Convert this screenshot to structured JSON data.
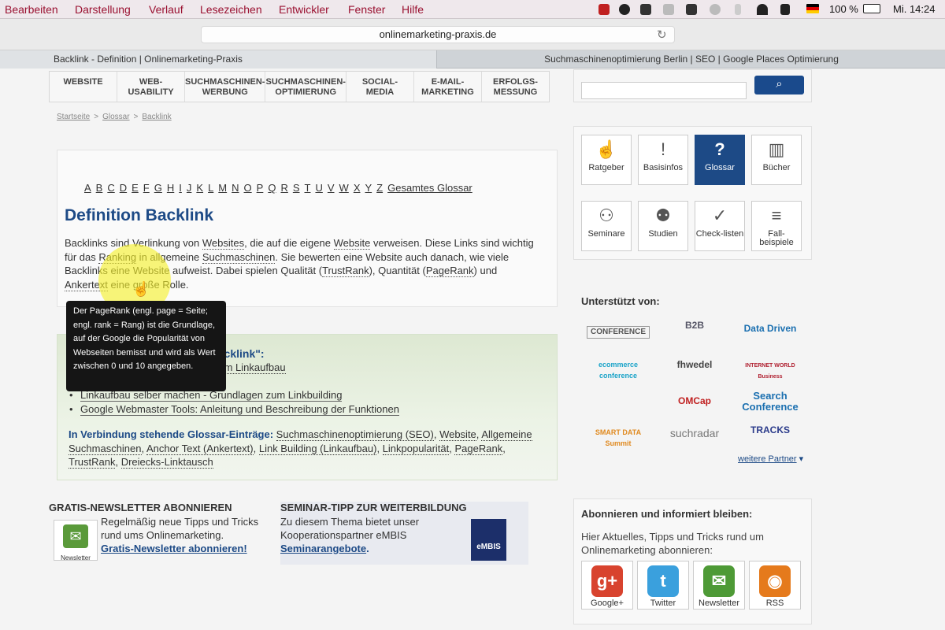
{
  "menubar": {
    "items": [
      "Bearbeiten",
      "Darstellung",
      "Verlauf",
      "Lesezeichen",
      "Entwickler",
      "Fenster",
      "Hilfe"
    ],
    "battery": "100 %",
    "clock": "Mi. 14:24"
  },
  "browser": {
    "url": "onlinemarketing-praxis.de",
    "tabs": [
      "Backlink - Definition | Onlinemarketing-Praxis",
      "Suchmaschinenoptimierung Berlin | SEO | Google Places Optimierung"
    ]
  },
  "nav": [
    "WEBSITE",
    "WEB-\nUSABILITY",
    "SUCHMASCHINEN-\nWERBUNG",
    "SUCHMASCHINEN-\nOPTIMIERUNG",
    "SOCIAL-\nMEDIA",
    "E-MAIL-\nMARKETING",
    "ERFOLGS-\nMESSUNG"
  ],
  "breadcrumb": [
    "Startseite",
    "Glossar",
    "Backlink"
  ],
  "alphabet": [
    "A",
    "B",
    "C",
    "D",
    "E",
    "F",
    "G",
    "H",
    "I",
    "J",
    "K",
    "L",
    "M",
    "N",
    "O",
    "P",
    "Q",
    "R",
    "S",
    "T",
    "U",
    "V",
    "W",
    "X",
    "Y",
    "Z"
  ],
  "alphabet_all": "Gesamtes Glossar",
  "definition": {
    "title": "Definition Backlink",
    "p1": "Backlinks sind Verlinkung von ",
    "w1": "Websites",
    "p2": ", die auf die eigene ",
    "w2": "Website",
    "p3": " verweisen. Diese Links sind wichtig für das ",
    "w3": "Ranking",
    "p4": " in allgemeine ",
    "w4": "Suchmaschinen",
    "p5": ". Sie bewerten eine Website auch danach, wie viele Backlinks eine Website aufweist. Dabei spielen Qualität (",
    "w5": "TrustRank",
    "p6": "), Quantität (",
    "w6": "PageRank",
    "p7": ") und ",
    "w7": "Ankertext",
    "p8": " eine große Rolle."
  },
  "tooltip": "Der PageRank (engl. page = Seite; engl. rank = Rang) ist die Grundlage, auf der Google die Popularität von Webseiten bemisst und wird als Wert zwischen 0 und 10 angegeben.",
  "related": {
    "heading": "\"Backlink\":",
    "link1": "d zum Linkaufbau",
    "links": [
      "Linkaufbau selber machen - Grundlagen zum Linkbuilding",
      "Google Webmaster Tools: Anleitung und Beschreibung der Funktionen"
    ],
    "glossar_label": "In Verbindung stehende Glossar-Einträge:",
    "glossar_items": [
      "Suchmaschinenoptimierung (SEO)",
      "Website",
      "Allgemeine Suchmaschinen",
      "Anchor Text (Ankertext)",
      "Link Building (Linkaufbau)",
      "Linkpopularität",
      "PageRank",
      "TrustRank",
      "Dreiecks-Linktausch"
    ]
  },
  "newsletter": {
    "heading": "GRATIS-NEWSLETTER ABONNIEREN",
    "icon_label": "Newsletter",
    "text": "Regelmäßig neue Tipps und Tricks rund ums Onlinemarketing.",
    "link": "Gratis-Newsletter abonnieren!"
  },
  "seminar": {
    "heading": "SEMINAR-TIPP ZUR WEITERBILDUNG",
    "text": "Zu diesem Thema bietet unser Kooperationspartner eMBIS",
    "link": "Seminarangebote",
    "suffix": ".",
    "logo": "eMBIS"
  },
  "sidebar_tiles": [
    {
      "label": "Ratgeber",
      "glyph": "☝"
    },
    {
      "label": "Basisinfos",
      "glyph": "!"
    },
    {
      "label": "Glossar",
      "glyph": "?"
    },
    {
      "label": "Bücher",
      "glyph": "📖"
    },
    {
      "label": "Seminare",
      "glyph": "👥"
    },
    {
      "label": "Studien",
      "glyph": "📊"
    },
    {
      "label": "Check-listen",
      "glyph": "✓"
    },
    {
      "label": "Fall-beispiele",
      "glyph": "📄"
    }
  ],
  "supporters": {
    "heading": "Unterstützt von:",
    "logos": [
      "CONFERENCE",
      "B2B",
      "Data Driven",
      "ecommerce conference",
      "fhwedel",
      "INTERNET WORLD Business",
      "",
      "OMCap",
      "Search Conference",
      "SMART DATA Summit",
      "suchradar",
      "TRACKS"
    ],
    "more": "weitere Partner"
  },
  "subscribe": {
    "heading": "Abonnieren und informiert bleiben:",
    "text": "Hier Aktuelles, Tipps und Tricks rund um Onlinemarketing abonnieren:",
    "items": [
      {
        "label": "Google+",
        "glyph": "g+",
        "color": "#d8432e"
      },
      {
        "label": "Twitter",
        "glyph": "🐦",
        "color": "#3aa0dd"
      },
      {
        "label": "Newsletter",
        "glyph": "✉",
        "color": "#4e9a36"
      },
      {
        "label": "RSS",
        "glyph": "◉",
        "color": "#e57a1c"
      }
    ]
  }
}
